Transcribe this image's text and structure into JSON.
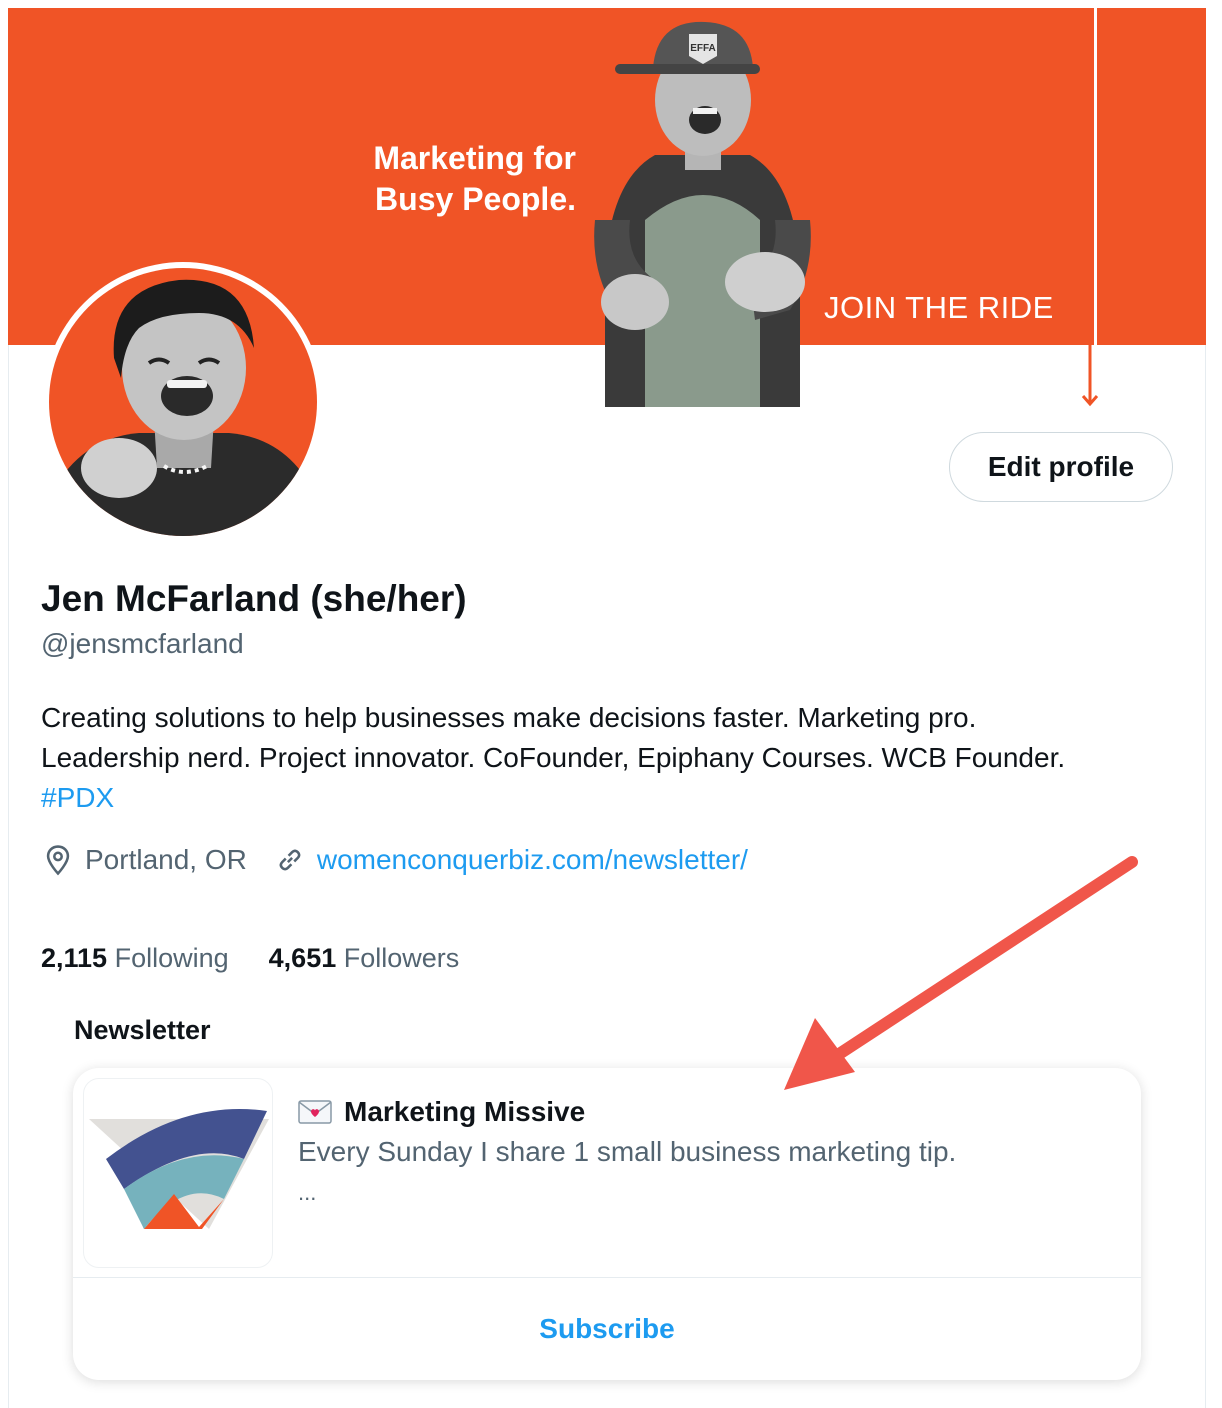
{
  "banner": {
    "tagline_line1": "Marketing for",
    "tagline_line2": "Busy People.",
    "cta": "JOIN THE RIDE",
    "cap_text": "EFFA",
    "color": "#f05426"
  },
  "profile": {
    "edit_button": "Edit profile",
    "name": "Jen McFarland (she/her)",
    "handle": "@jensmcfarland",
    "bio_line1": "Creating solutions to help businesses make decisions faster. Marketing pro.",
    "bio_line2": "Leadership nerd. Project innovator. CoFounder, Epiphany Courses. WCB Founder.",
    "bio_hashtag": "#PDX",
    "location": "Portland, OR",
    "website": "womenconquerbiz.com/newsletter/"
  },
  "stats": {
    "following_count": "2,115",
    "following_label": "Following",
    "followers_count": "4,651",
    "followers_label": "Followers"
  },
  "newsletter": {
    "section_title": "Newsletter",
    "title": "Marketing Missive",
    "description": "Every Sunday I share 1 small business marketing tip.",
    "more": "...",
    "subscribe": "Subscribe",
    "emoji_icon": "love-letter-icon"
  },
  "colors": {
    "accent_blue": "#1d9bf0",
    "annotation_red": "#f0564a",
    "text_primary": "#0f1419",
    "text_secondary": "#536471"
  }
}
